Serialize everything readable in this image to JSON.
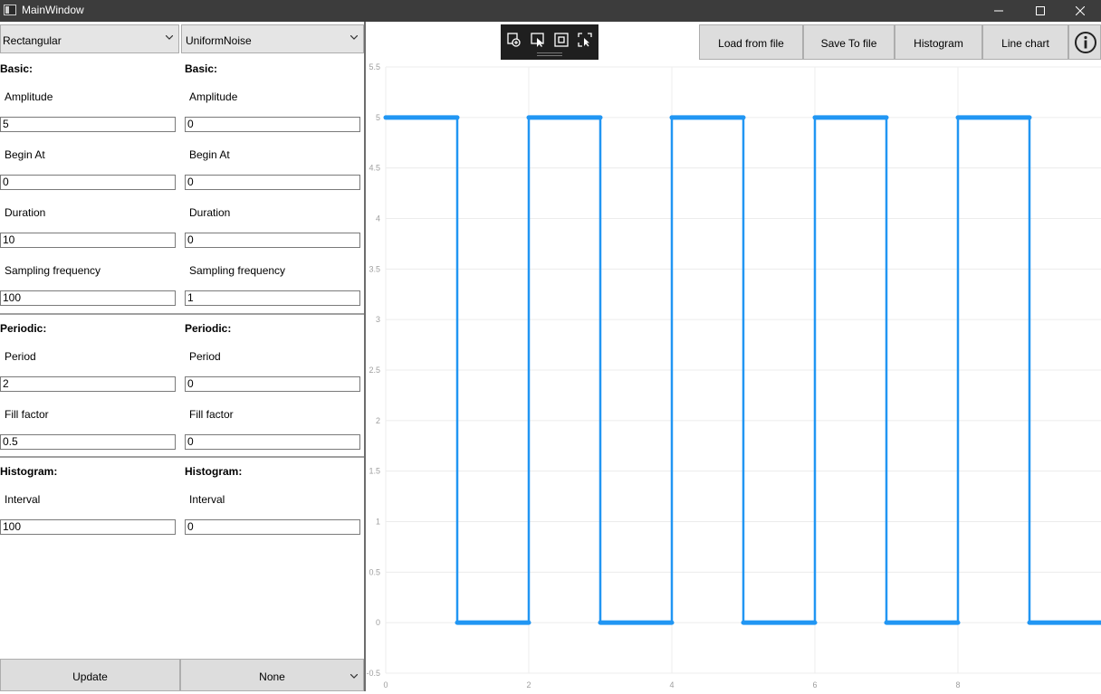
{
  "window": {
    "title": "MainWindow"
  },
  "left_panel": {
    "signal_type_1": "Rectangular",
    "signal_type_2": "UniformNoise",
    "col1": {
      "basic_header": "Basic:",
      "amplitude_label": "Amplitude",
      "amplitude_value": "5",
      "begin_label": "Begin At",
      "begin_value": "0",
      "duration_label": "Duration",
      "duration_value": "10",
      "sampling_label": "Sampling frequency",
      "sampling_value": "100",
      "periodic_header": "Periodic:",
      "period_label": "Period",
      "period_value": "2",
      "fill_label": "Fill factor",
      "fill_value": "0.5",
      "histogram_header": "Histogram:",
      "interval_label": "Interval",
      "interval_value": "100"
    },
    "col2": {
      "basic_header": "Basic:",
      "amplitude_label": "Amplitude",
      "amplitude_value": "0",
      "begin_label": "Begin At",
      "begin_value": "0",
      "duration_label": "Duration",
      "duration_value": "0",
      "sampling_label": "Sampling frequency",
      "sampling_value": "1",
      "periodic_header": "Periodic:",
      "period_label": "Period",
      "period_value": "0",
      "fill_label": "Fill factor",
      "fill_value": "0",
      "histogram_header": "Histogram:",
      "interval_label": "Interval",
      "interval_value": "0"
    },
    "update_label": "Update",
    "operation_value": "None"
  },
  "toolbar": {
    "load_label": "Load from file",
    "save_label": "Save To file",
    "histogram_label": "Histogram",
    "linechart_label": "Line chart",
    "tools": [
      "zoom-add-icon",
      "select-pointer-icon",
      "fit-frame-icon",
      "zoom-select-icon"
    ]
  },
  "colors": {
    "series": "#2196f3",
    "titlebar": "#3c3c3c"
  },
  "chart_data": {
    "type": "line",
    "xlim": [
      0,
      10
    ],
    "ylim": [
      -0.5,
      5.5
    ],
    "x_ticks": [
      0,
      2,
      4,
      6,
      8
    ],
    "y_ticks": [
      -0.5,
      0,
      0.5,
      1,
      1.5,
      2,
      2.5,
      3,
      3.5,
      4,
      4.5,
      5,
      5.5
    ],
    "grid": true,
    "series": [
      {
        "x": [
          0,
          1,
          1,
          2,
          2,
          3,
          3,
          4,
          4,
          5,
          5,
          6,
          6,
          7,
          7,
          8,
          8,
          9,
          9,
          10
        ],
        "values": [
          5,
          5,
          0,
          0,
          5,
          5,
          0,
          0,
          5,
          5,
          0,
          0,
          5,
          5,
          0,
          0,
          5,
          5,
          0,
          0
        ]
      }
    ]
  }
}
